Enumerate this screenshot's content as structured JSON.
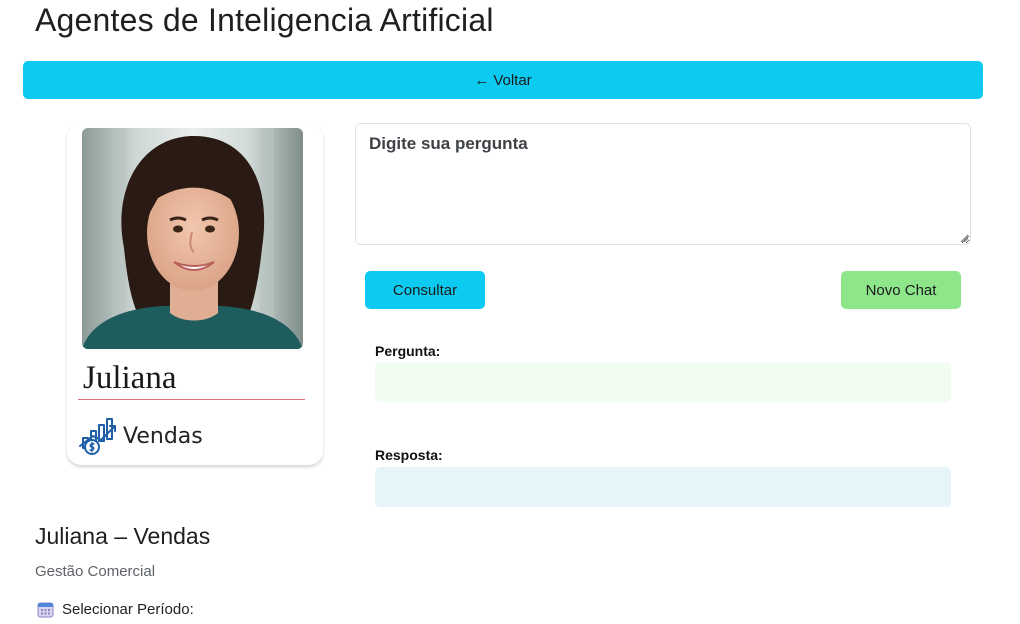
{
  "page": {
    "title": "Agentes de Inteligencia Artificial"
  },
  "nav": {
    "back_arrow": "←",
    "back_label": "Voltar"
  },
  "agent": {
    "name": "Juliana",
    "department": "Vendas",
    "department_icon": "sales-chart-dollar-icon"
  },
  "chat": {
    "question_placeholder": "Digite sua pergunta",
    "question_value": "",
    "consult_label": "Consultar",
    "new_chat_label": "Novo Chat",
    "question_heading": "Pergunta:",
    "question_content": "",
    "answer_heading": "Resposta:",
    "answer_content": ""
  },
  "section": {
    "title": "Juliana – Vendas",
    "subtitle": "Gestão Comercial",
    "period_icon": "calendar-icon",
    "period_label": "Selecionar Período:"
  },
  "colors": {
    "accent_info": "#0dcaf0",
    "accent_success": "#8ee68a",
    "question_bg": "#f0fdf0",
    "answer_bg": "#e5f5f9",
    "name_underline": "#e06d7a"
  }
}
